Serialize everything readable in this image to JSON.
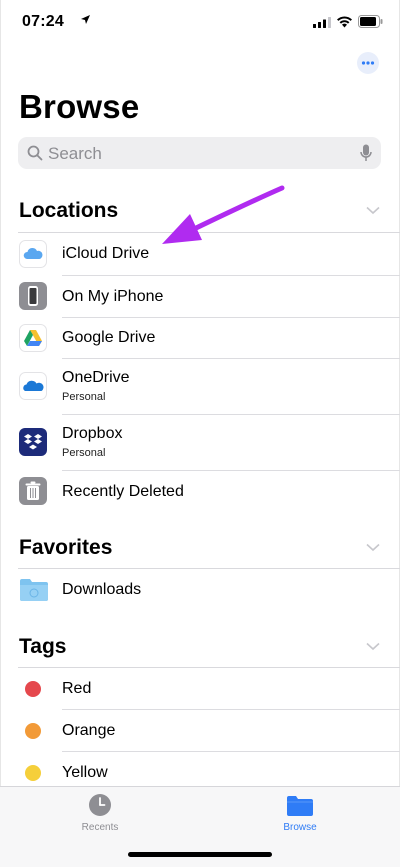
{
  "status_bar": {
    "time": "07:24"
  },
  "header": {
    "title": "Browse"
  },
  "search": {
    "placeholder": "Search"
  },
  "sections": {
    "locations": "Locations",
    "favorites": "Favorites",
    "tags": "Tags"
  },
  "locations": [
    {
      "label": "iCloud Drive",
      "icon": "icloud-icon"
    },
    {
      "label": "On My iPhone",
      "icon": "iphone-icon"
    },
    {
      "label": "Google Drive",
      "icon": "google-drive-icon"
    },
    {
      "label": "OneDrive",
      "sublabel": "Personal",
      "icon": "onedrive-icon"
    },
    {
      "label": "Dropbox",
      "sublabel": "Personal",
      "icon": "dropbox-icon"
    },
    {
      "label": "Recently Deleted",
      "icon": "trash-icon"
    }
  ],
  "favorites": [
    {
      "label": "Downloads",
      "icon": "folder-icon"
    }
  ],
  "tags": [
    {
      "label": "Red",
      "color": "#e5484d"
    },
    {
      "label": "Orange",
      "color": "#f29a38"
    },
    {
      "label": "Yellow",
      "color": "#f5cf3a"
    }
  ],
  "tabbar": {
    "recents": "Recents",
    "browse": "Browse"
  },
  "colors": {
    "accent": "#2f7cf6",
    "annotation_arrow": "#b02bf0"
  }
}
